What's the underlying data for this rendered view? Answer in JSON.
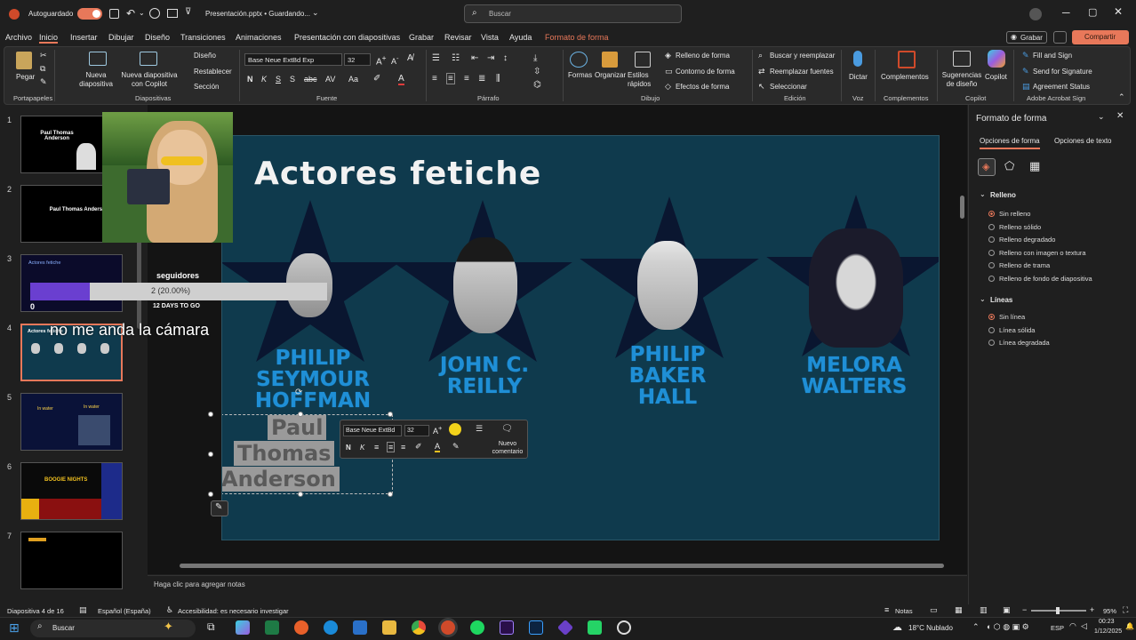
{
  "titlebar": {
    "autosave_label": "Autoguardado",
    "autosave_toggle": "On",
    "file_title": "Presentación.pptx • Guardando...",
    "search_placeholder": "Buscar"
  },
  "menu": {
    "tabs": [
      "Archivo",
      "Inicio",
      "Insertar",
      "Dibujar",
      "Diseño",
      "Transiciones",
      "Animaciones",
      "Presentación con diapositivas",
      "Grabar",
      "Revisar",
      "Vista",
      "Ayuda",
      "Formato de forma"
    ],
    "record_button": "Grabar",
    "share_button": "Compartir"
  },
  "ribbon": {
    "paste": "Pegar",
    "new_slide": "Nueva diapositiva",
    "new_slide_copilot": "Nueva diapositiva con Copilot",
    "diseno": "Diseño",
    "restablecer": "Restablecer",
    "seccion": "Sección",
    "font_name": "Base Neue ExtBd Exp",
    "font_size": "32",
    "formas": "Formas",
    "organizar": "Organizar",
    "estilos_rapidos": "Estilos rápidos",
    "relleno_forma": "Relleno de forma",
    "contorno_forma": "Contorno de forma",
    "efectos_forma": "Efectos de forma",
    "buscar_reemplazar": "Buscar y reemplazar",
    "reemplazar_fuentes": "Reemplazar fuentes",
    "seleccionar": "Seleccionar",
    "dictar": "Dictar",
    "complementos": "Complementos",
    "sugerencias": "Sugerencias de diseño",
    "copilot": "Copilot",
    "fill_sign": "Fill and Sign",
    "send_signature": "Send for Signature",
    "agreement_status": "Agreement Status",
    "groups": [
      "Portapapeles",
      "Diapositivas",
      "Fuente",
      "Párrafo",
      "Dibujo",
      "Edición",
      "Voz",
      "Complementos",
      "Copilot",
      "Adobe Acrobat Sign"
    ]
  },
  "thumbnails": [
    "1",
    "2",
    "3",
    "4",
    "5",
    "6",
    "7"
  ],
  "thumb_texts": {
    "t1": "Paul Thomas Anderson",
    "t2": "Paul Thomas Anderson",
    "t3": "Actores fetiche",
    "t5a": "In water",
    "t5b": "In water",
    "t6": "BOOGIE NIGHTS"
  },
  "stream_overlay": {
    "label": "seguidores",
    "progress_text": "2 (20.00%)",
    "progress_fraction": 0.2,
    "count_left": "0",
    "days": "12 DAYS TO GO",
    "caption": "no me anda la cámara"
  },
  "slide": {
    "title": "Actores fetiche",
    "actors": [
      "PHILIP SEYMOUR HOFFMAN",
      "JOHN C. REILLY",
      "PHILIP BAKER HALL",
      "MELORA WALTERS"
    ],
    "selected_text_lines": [
      "Paul",
      "Thomas",
      "Anderson"
    ]
  },
  "mini_toolbar": {
    "font": "Base Neue ExtBd",
    "size": "32",
    "new_comment": "Nuevo comentario"
  },
  "notes_placeholder": "Haga clic para agregar notas",
  "format_panel": {
    "title": "Formato de forma",
    "tab_shape": "Opciones de forma",
    "tab_text": "Opciones de texto",
    "fill_header": "Relleno",
    "fill_options": [
      "Sin relleno",
      "Relleno sólido",
      "Relleno degradado",
      "Relleno con imagen o textura",
      "Relleno de trama",
      "Relleno de fondo de diapositiva"
    ],
    "line_header": "Líneas",
    "line_options": [
      "Sin línea",
      "Línea sólida",
      "Línea degradada"
    ]
  },
  "status": {
    "slide_info": "Diapositiva 4 de 16",
    "language": "Español (España)",
    "accessibility": "Accesibilidad: es necesario investigar",
    "notes": "Notas",
    "zoom": "95%"
  },
  "taskbar": {
    "search": "Buscar",
    "weather": "18°C  Nublado",
    "lang": "ESP",
    "time": "00:23",
    "date": "1/12/2025"
  },
  "colors": {
    "accent": "#e8785a",
    "slide_bg": "#0f3a4d",
    "actor_blue": "#1f8fd6",
    "progress_purple": "#6a3fd0"
  }
}
